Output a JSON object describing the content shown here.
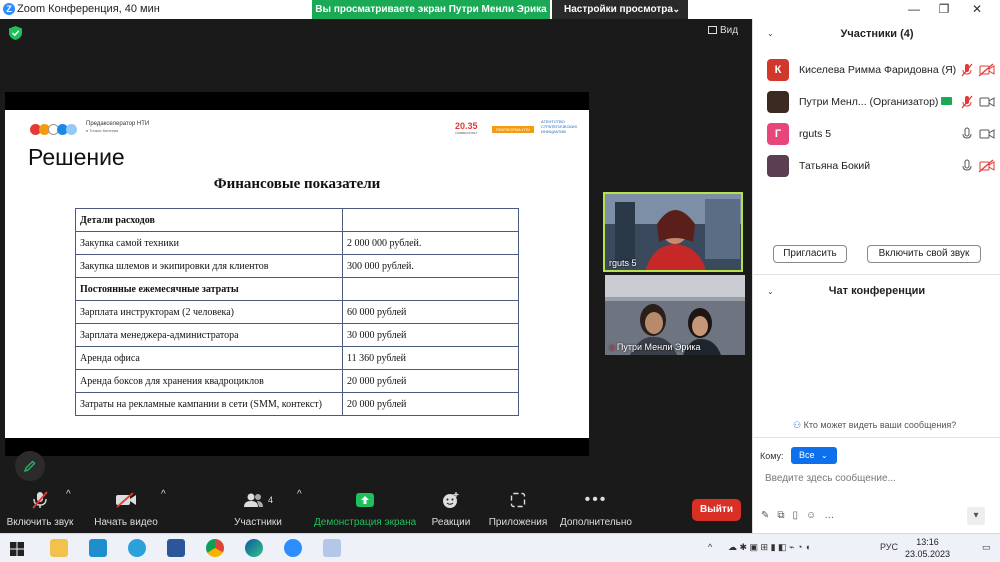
{
  "window": {
    "title": "Zoom Конференция, 40 мин",
    "logo": "Z",
    "sharing_banner": "Вы просматриваете экран Путри Менли Эрика",
    "view_settings": "Настройки просмотра",
    "view_button": "Вид"
  },
  "slide": {
    "brand_left": "Предакселератор НТИ",
    "brand_left_sub": "в Точках Кипения",
    "brand_2035": "20.35",
    "brand_2035_sub": "УНИВЕРСИТЕТ",
    "brand_orange": "ПЛАТФОРМА НТИ",
    "brand_blue": "АГЕНТСТВО СТРАТЕГИЧЕСКИХ ИНИЦИАТИВ",
    "title": "Решение",
    "subtitle": "Финансовые показатели",
    "table": [
      {
        "item": "Детали расходов",
        "value": "",
        "bold": true
      },
      {
        "item": "Закупка самой техники",
        "value": "2 000 000 рублей.",
        "bold": false
      },
      {
        "item": "Закупка шлемов и экипировки для клиентов",
        "value": "300 000 рублей.",
        "bold": false
      },
      {
        "item": "Постоянные ежемесячные затраты",
        "value": "",
        "bold": true
      },
      {
        "item": "Зарплата инструкторам (2 человека)",
        "value": "60 000 рублей",
        "bold": false
      },
      {
        "item": "Зарплата менеджера-администратора",
        "value": "30 000 рублей",
        "bold": false
      },
      {
        "item": "Аренда офиса",
        "value": "11 360 рублей",
        "bold": false
      },
      {
        "item": "Аренда боксов для хранения квадроциклов",
        "value": "20 000 рублей",
        "bold": false
      },
      {
        "item": "Затраты на рекламные кампании в сети (SMM, контекст)",
        "value": "20 000 рублей",
        "bold": false
      }
    ]
  },
  "videos": [
    {
      "name": "rguts 5",
      "muted": false
    },
    {
      "name": "Путри Менли Эрика",
      "muted": true
    }
  ],
  "toolbar": {
    "audio": "Включить звук",
    "video": "Начать видео",
    "participants": "Участники",
    "participants_count": "4",
    "share": "Демонстрация экрана",
    "reactions": "Реакции",
    "apps": "Приложения",
    "more": "Дополнительно",
    "leave": "Выйти"
  },
  "participants_panel": {
    "title": "Участники (4)",
    "list": [
      {
        "initial": "К",
        "name": "Киселева Римма Фаридовна (Я)",
        "color": "#d1382b"
      },
      {
        "initial": "",
        "name": "Путри Менл... (Организатор)",
        "color": "#3a2a22"
      },
      {
        "initial": "Г",
        "name": "rguts 5",
        "color": "#e8457a"
      },
      {
        "initial": "",
        "name": "Татьяна Бокий",
        "color": "#5a3f52"
      }
    ],
    "invite": "Пригласить",
    "unmute": "Включить свой звук"
  },
  "chat": {
    "title": "Чат конференции",
    "who_can_see": "Кто может видеть ваши сообщения?",
    "to_label": "Кому:",
    "to_value": "Все",
    "placeholder": "Введите здесь сообщение..."
  },
  "taskbar": {
    "lang": "РУС",
    "time": "13:16",
    "date": "23.05.2023"
  }
}
